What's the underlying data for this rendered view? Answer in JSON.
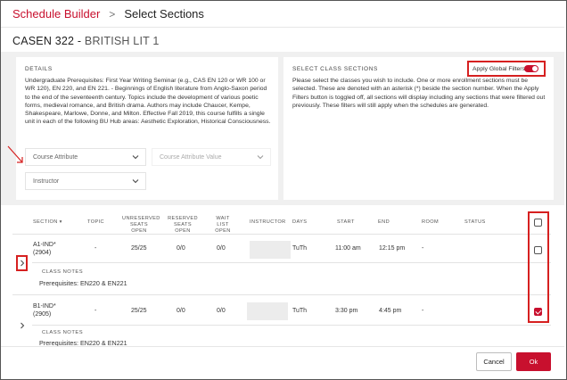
{
  "breadcrumb": {
    "parent": "Schedule Builder",
    "separator": ">",
    "current": "Select Sections"
  },
  "course": {
    "code": "CASEN 322",
    "dash": " - ",
    "name": "BRITISH LIT 1"
  },
  "details": {
    "label": "DETAILS",
    "text": "Undergraduate Prerequisites: First Year Writing Seminar (e.g., CAS EN 120 or WR 100 or WR 120), EN 220, and EN 221. - Beginnings of English literature from Anglo-Saxon period to the end of the seventeenth century. Topics include the development of various poetic forms, medieval romance, and British drama. Authors may include Chaucer, Kempe, Shakespeare, Marlowe, Donne, and Milton. Effective Fall 2019, this course fulfills a single unit in each of the following BU Hub areas: Aesthetic Exploration, Historical Consciousness."
  },
  "filters": {
    "course_attribute": "Course Attribute",
    "course_attribute_value": "Course Attribute Value",
    "instructor": "Instructor"
  },
  "select_sections": {
    "label": "SELECT CLASS SECTIONS",
    "toggle_label": "Apply Global Filters",
    "toggle_on": true,
    "text": "Please select the classes you wish to include. One or more enrollment sections must be selected. These are denoted with an asterisk (*) beside the section number. When the Apply Filters button is toggled off, all sections will display including any sections that were filtered out previously. These filters will still apply when the schedules are generated."
  },
  "table": {
    "columns": {
      "section": "SECTION",
      "topic": "TOPIC",
      "unreserved": "UNRESERVED SEATS OPEN",
      "reserved": "RESERVED SEATS OPEN",
      "waitlist": "WAIT LIST OPEN",
      "instructor": "INSTRUCTOR",
      "days": "DAYS",
      "start": "START",
      "end": "END",
      "room": "ROOM",
      "status": "STATUS"
    },
    "rows": [
      {
        "section": "A1-IND*",
        "class_no": "(2904)",
        "topic": "-",
        "unreserved": "25/25",
        "reserved": "0/0",
        "waitlist": "0/0",
        "days": "TuTh",
        "start": "11:00 am",
        "end": "12:15 pm",
        "room": "-",
        "notes_label": "CLASS NOTES",
        "notes": "Prerequisites: EN220 & EN221",
        "selected": false
      },
      {
        "section": "B1-IND*",
        "class_no": "(2905)",
        "topic": "-",
        "unreserved": "25/25",
        "reserved": "0/0",
        "waitlist": "0/0",
        "days": "TuTh",
        "start": "3:30 pm",
        "end": "4:45 pm",
        "room": "-",
        "notes_label": "CLASS NOTES",
        "notes": "Prerequisites: EN220 & EN221",
        "selected": true
      }
    ]
  },
  "footer": {
    "cancel": "Cancel",
    "ok": "Ok"
  },
  "colors": {
    "accent": "#c8102e",
    "highlight": "#d62020"
  }
}
